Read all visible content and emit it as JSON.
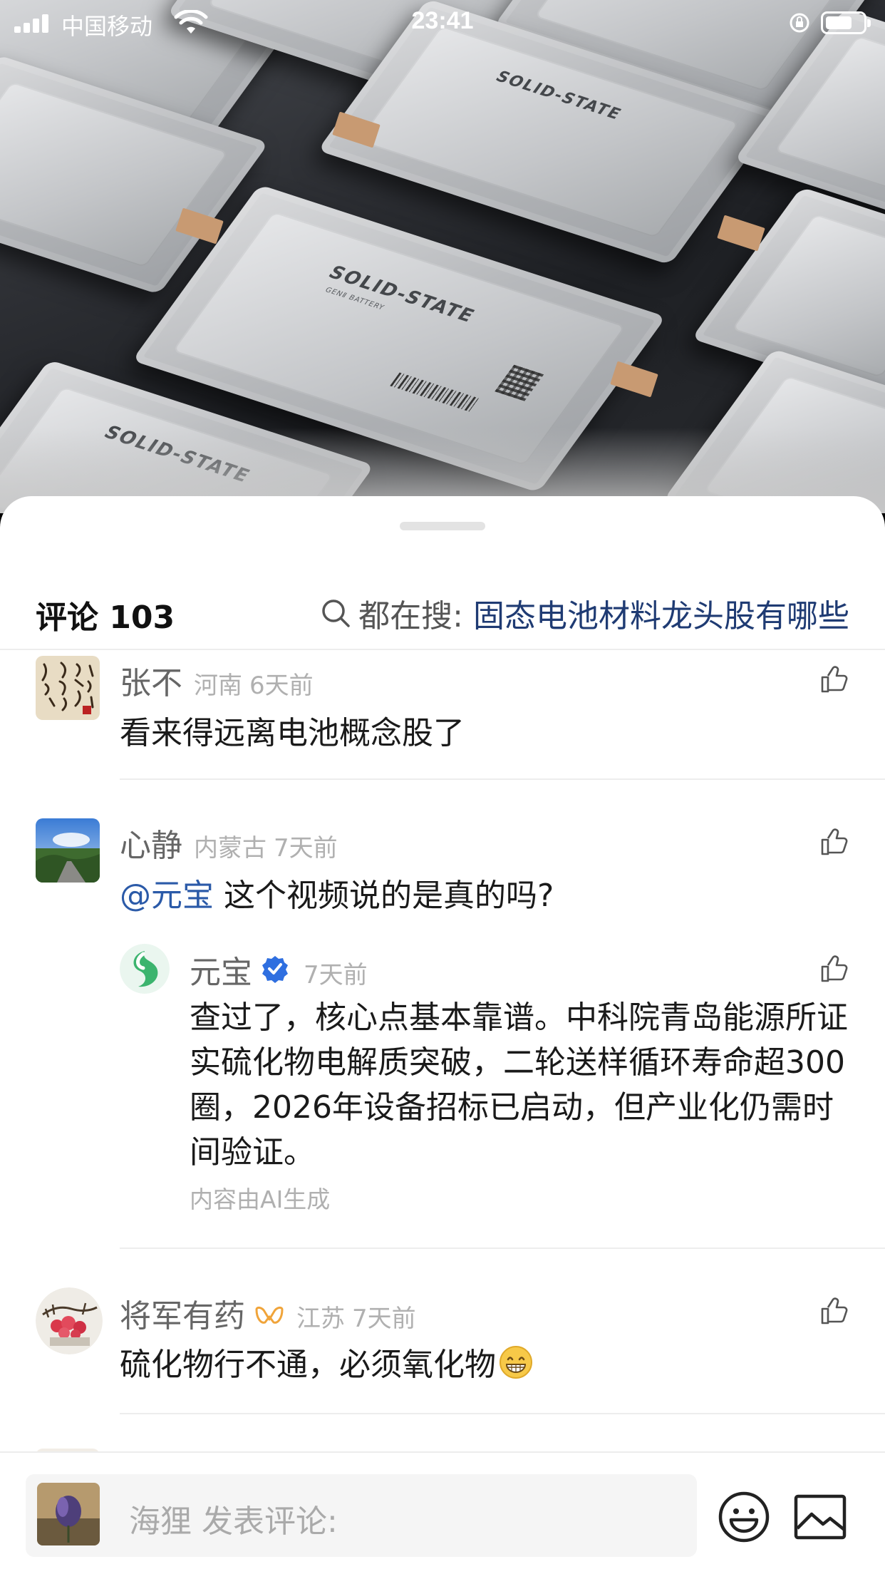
{
  "status_bar": {
    "carrier": "中国移动",
    "time": "23:41"
  },
  "hero": {
    "cell_label": "SOLID-STATE",
    "cell_sublabel": "GENⅡ BATTERY"
  },
  "header": {
    "comments_label": "评论 103",
    "search_prefix": "都在搜:",
    "search_query": "固态电池材料龙头股有哪些"
  },
  "comments": [
    {
      "name": "张不",
      "location": "河南",
      "time": "6天前",
      "text": "看来得远离电池概念股了"
    },
    {
      "name": "心静",
      "location": "内蒙古",
      "time": "7天前",
      "mention": "@元宝",
      "text": "这个视频说的是真的吗?",
      "reply": {
        "name": "元宝",
        "time": "7天前",
        "text": "查过了，核心点基本靠谱。中科院青岛能源所证实硫化物电解质突破，二轮送样循环寿命超300圈，2026年设备招标已启动，但产业化仍需时间验证。",
        "note": "内容由AI生成"
      }
    },
    {
      "name": "将军有药",
      "location": "江苏",
      "time": "7天前",
      "text": "硫化物行不通，必须氧化物"
    }
  ],
  "input": {
    "user": "海狸",
    "placeholder": "发表评论:"
  },
  "colors": {
    "link": "#2b5aa8",
    "search_query": "#1f3b73",
    "verified": "#2f6fe0",
    "yuanbao_green": "#3cb46e"
  }
}
